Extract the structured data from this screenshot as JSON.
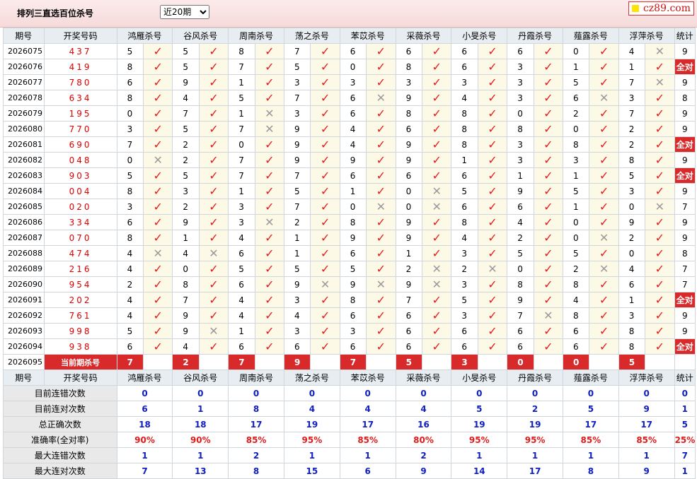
{
  "header": {
    "title": "排列三直选百位杀号",
    "period_select": "近20期",
    "logo": "cz89.com"
  },
  "columns": {
    "period": "期号",
    "draw": "开奖号码",
    "count": "统计",
    "experts": [
      "鸿雁杀号",
      "谷风杀号",
      "周南杀号",
      "荡之杀号",
      "苯苡杀号",
      "采薇杀号",
      "小旻杀号",
      "丹霞杀号",
      "薤露杀号",
      "浮萍杀号"
    ]
  },
  "rows": [
    {
      "period": "2026075",
      "draw": "437",
      "kills": [
        "5",
        "5",
        "8",
        "7",
        "6",
        "6",
        "6",
        "6",
        "0",
        "4"
      ],
      "hits": [
        1,
        1,
        1,
        1,
        1,
        1,
        1,
        1,
        1,
        0
      ],
      "count": "9"
    },
    {
      "period": "2026076",
      "draw": "419",
      "kills": [
        "8",
        "5",
        "7",
        "5",
        "0",
        "8",
        "6",
        "3",
        "1",
        "1"
      ],
      "hits": [
        1,
        1,
        1,
        1,
        1,
        1,
        1,
        1,
        1,
        1
      ],
      "count": "全对"
    },
    {
      "period": "2026077",
      "draw": "780",
      "kills": [
        "6",
        "9",
        "1",
        "3",
        "3",
        "3",
        "3",
        "3",
        "5",
        "7"
      ],
      "hits": [
        1,
        1,
        1,
        1,
        1,
        1,
        1,
        1,
        1,
        0
      ],
      "count": "9"
    },
    {
      "period": "2026078",
      "draw": "634",
      "kills": [
        "8",
        "4",
        "5",
        "7",
        "6",
        "9",
        "4",
        "3",
        "6",
        "3"
      ],
      "hits": [
        1,
        1,
        1,
        1,
        0,
        1,
        1,
        1,
        0,
        1
      ],
      "count": "8"
    },
    {
      "period": "2026079",
      "draw": "195",
      "kills": [
        "0",
        "7",
        "1",
        "3",
        "6",
        "8",
        "8",
        "0",
        "2",
        "7"
      ],
      "hits": [
        1,
        1,
        0,
        1,
        1,
        1,
        1,
        1,
        1,
        1
      ],
      "count": "9"
    },
    {
      "period": "2026080",
      "draw": "770",
      "kills": [
        "3",
        "5",
        "7",
        "9",
        "4",
        "6",
        "8",
        "8",
        "0",
        "2"
      ],
      "hits": [
        1,
        1,
        0,
        1,
        1,
        1,
        1,
        1,
        1,
        1
      ],
      "count": "9"
    },
    {
      "period": "2026081",
      "draw": "690",
      "kills": [
        "7",
        "2",
        "0",
        "9",
        "4",
        "9",
        "8",
        "3",
        "8",
        "2"
      ],
      "hits": [
        1,
        1,
        1,
        1,
        1,
        1,
        1,
        1,
        1,
        1
      ],
      "count": "全对"
    },
    {
      "period": "2026082",
      "draw": "048",
      "kills": [
        "0",
        "2",
        "7",
        "9",
        "9",
        "9",
        "1",
        "3",
        "3",
        "8"
      ],
      "hits": [
        0,
        1,
        1,
        1,
        1,
        1,
        1,
        1,
        1,
        1
      ],
      "count": "9"
    },
    {
      "period": "2026083",
      "draw": "903",
      "kills": [
        "5",
        "5",
        "7",
        "7",
        "6",
        "6",
        "6",
        "1",
        "1",
        "5"
      ],
      "hits": [
        1,
        1,
        1,
        1,
        1,
        1,
        1,
        1,
        1,
        1
      ],
      "count": "全对"
    },
    {
      "period": "2026084",
      "draw": "004",
      "kills": [
        "8",
        "3",
        "1",
        "5",
        "1",
        "0",
        "5",
        "9",
        "5",
        "3"
      ],
      "hits": [
        1,
        1,
        1,
        1,
        1,
        0,
        1,
        1,
        1,
        1
      ],
      "count": "9"
    },
    {
      "period": "2026085",
      "draw": "020",
      "kills": [
        "3",
        "2",
        "3",
        "7",
        "0",
        "0",
        "6",
        "6",
        "1",
        "0"
      ],
      "hits": [
        1,
        1,
        1,
        1,
        0,
        0,
        1,
        1,
        1,
        0
      ],
      "count": "7"
    },
    {
      "period": "2026086",
      "draw": "334",
      "kills": [
        "6",
        "9",
        "3",
        "2",
        "8",
        "9",
        "8",
        "4",
        "0",
        "9"
      ],
      "hits": [
        1,
        1,
        0,
        1,
        1,
        1,
        1,
        1,
        1,
        1
      ],
      "count": "9"
    },
    {
      "period": "2026087",
      "draw": "070",
      "kills": [
        "8",
        "1",
        "4",
        "1",
        "9",
        "9",
        "4",
        "2",
        "0",
        "2"
      ],
      "hits": [
        1,
        1,
        1,
        1,
        1,
        1,
        1,
        1,
        0,
        1
      ],
      "count": "9"
    },
    {
      "period": "2026088",
      "draw": "474",
      "kills": [
        "4",
        "4",
        "6",
        "1",
        "6",
        "1",
        "3",
        "5",
        "5",
        "0"
      ],
      "hits": [
        0,
        0,
        1,
        1,
        1,
        1,
        1,
        1,
        1,
        1
      ],
      "count": "8"
    },
    {
      "period": "2026089",
      "draw": "216",
      "kills": [
        "4",
        "0",
        "5",
        "5",
        "5",
        "2",
        "2",
        "0",
        "2",
        "4"
      ],
      "hits": [
        1,
        1,
        1,
        1,
        1,
        0,
        0,
        1,
        0,
        1
      ],
      "count": "7"
    },
    {
      "period": "2026090",
      "draw": "954",
      "kills": [
        "2",
        "8",
        "6",
        "9",
        "9",
        "9",
        "3",
        "8",
        "8",
        "6"
      ],
      "hits": [
        1,
        1,
        1,
        0,
        0,
        0,
        1,
        1,
        1,
        1
      ],
      "count": "7"
    },
    {
      "period": "2026091",
      "draw": "202",
      "kills": [
        "4",
        "7",
        "4",
        "3",
        "8",
        "7",
        "5",
        "9",
        "4",
        "1"
      ],
      "hits": [
        1,
        1,
        1,
        1,
        1,
        1,
        1,
        1,
        1,
        1
      ],
      "count": "全对"
    },
    {
      "period": "2026092",
      "draw": "761",
      "kills": [
        "4",
        "9",
        "4",
        "4",
        "6",
        "6",
        "3",
        "7",
        "8",
        "3"
      ],
      "hits": [
        1,
        1,
        1,
        1,
        1,
        1,
        1,
        0,
        1,
        1
      ],
      "count": "9"
    },
    {
      "period": "2026093",
      "draw": "998",
      "kills": [
        "5",
        "9",
        "1",
        "3",
        "3",
        "6",
        "6",
        "6",
        "6",
        "8"
      ],
      "hits": [
        1,
        0,
        1,
        1,
        1,
        1,
        1,
        1,
        1,
        1
      ],
      "count": "9"
    },
    {
      "period": "2026094",
      "draw": "938",
      "kills": [
        "6",
        "4",
        "6",
        "6",
        "6",
        "6",
        "6",
        "6",
        "6",
        "8"
      ],
      "hits": [
        1,
        1,
        1,
        1,
        1,
        1,
        1,
        1,
        1,
        1
      ],
      "count": "全对"
    }
  ],
  "current": {
    "period": "2026095",
    "label": "当前期杀号",
    "kills": [
      "7",
      "2",
      "7",
      "9",
      "7",
      "5",
      "3",
      "0",
      "0",
      "5"
    ]
  },
  "stats": [
    {
      "label": "目前连错次数",
      "values": [
        "0",
        "0",
        "0",
        "0",
        "0",
        "0",
        "0",
        "0",
        "0",
        "0"
      ],
      "total": "0"
    },
    {
      "label": "目前连对次数",
      "values": [
        "6",
        "1",
        "8",
        "4",
        "4",
        "4",
        "5",
        "2",
        "5",
        "9"
      ],
      "total": "1"
    },
    {
      "label": "总正确次数",
      "values": [
        "18",
        "18",
        "17",
        "19",
        "17",
        "16",
        "19",
        "19",
        "17",
        "17"
      ],
      "total": "5"
    },
    {
      "label": "准确率(全对率)",
      "values": [
        "90%",
        "90%",
        "85%",
        "95%",
        "85%",
        "80%",
        "95%",
        "95%",
        "85%",
        "85%"
      ],
      "total": "25%"
    },
    {
      "label": "最大连错次数",
      "values": [
        "1",
        "1",
        "2",
        "1",
        "1",
        "2",
        "1",
        "1",
        "1",
        "1"
      ],
      "total": "7"
    },
    {
      "label": "最大连对次数",
      "values": [
        "7",
        "13",
        "8",
        "15",
        "6",
        "9",
        "14",
        "17",
        "8",
        "9"
      ],
      "total": "1"
    }
  ],
  "marks": {
    "hit": "✓",
    "miss": "✕"
  },
  "colors": {
    "hit": "#e51b1b",
    "miss": "#9a9a9a",
    "highlight": "#d82a2a",
    "stat_value": "#1020c0"
  }
}
